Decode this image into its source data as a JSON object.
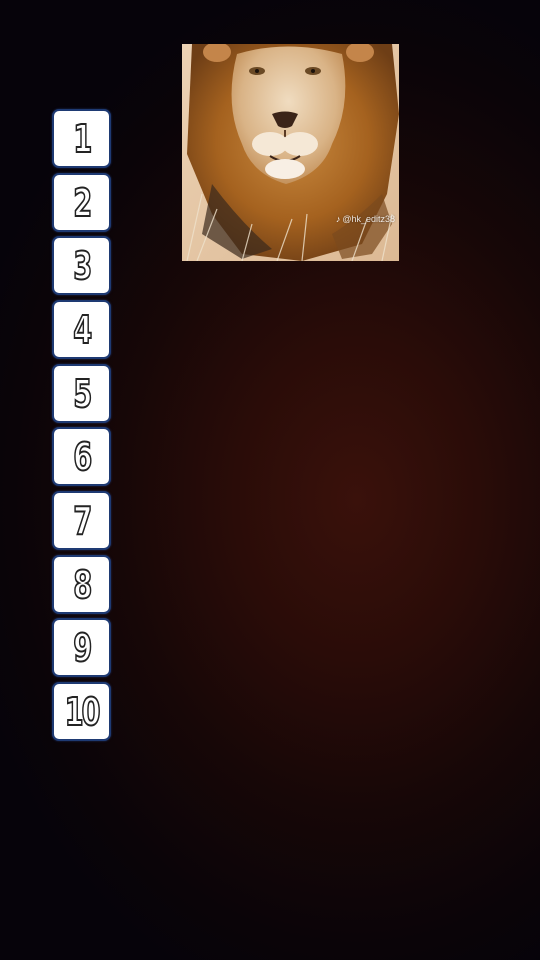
{
  "photo": {
    "subject": "lion portrait",
    "watermark": "@hk_editz38",
    "watermark_icon": "tiktok-icon"
  },
  "list": {
    "items": [
      {
        "label": "1"
      },
      {
        "label": "2"
      },
      {
        "label": "3"
      },
      {
        "label": "4"
      },
      {
        "label": "5"
      },
      {
        "label": "6"
      },
      {
        "label": "7"
      },
      {
        "label": "8"
      },
      {
        "label": "9"
      },
      {
        "label": "10"
      }
    ]
  },
  "colors": {
    "item_fill": "#ffffff",
    "item_border": "#1e3a73",
    "background_glow": "#3a110b",
    "background_edge": "#06030a"
  }
}
